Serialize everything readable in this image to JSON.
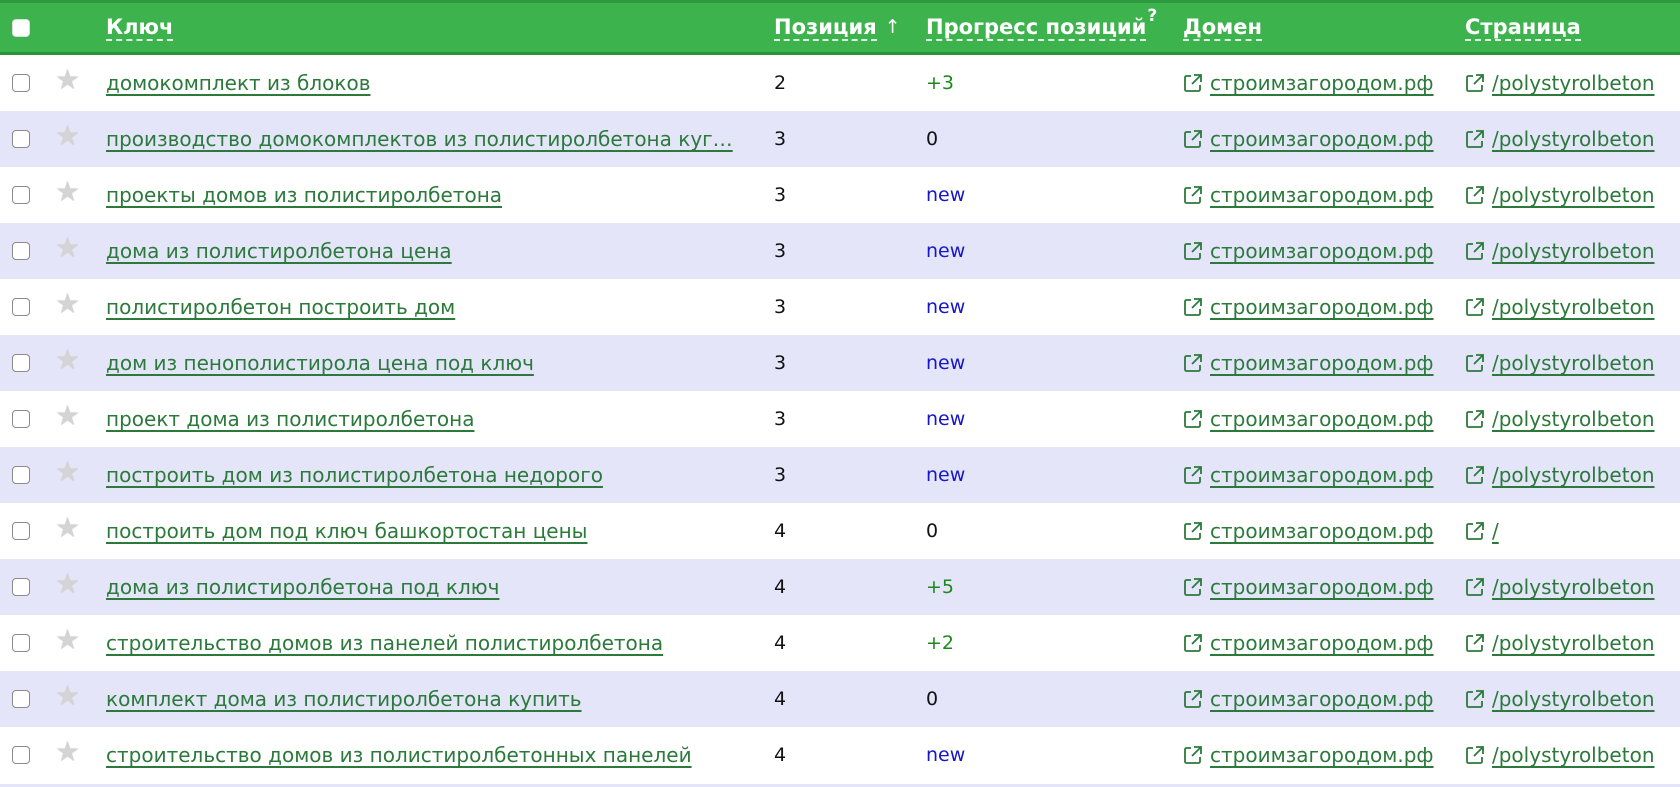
{
  "header": {
    "key_label": "Ключ",
    "position_label": "Позиция",
    "sort_indicator": "↑",
    "progress_label": "Прогресс позиций",
    "progress_help": "?",
    "domain_label": "Домен",
    "page_label": "Страница"
  },
  "icons": {
    "star": "star-icon",
    "external": "external-link-icon"
  },
  "colors": {
    "header_bg": "#3db34d",
    "alt_row_bg": "#e5e5fa",
    "link": "#2b7a3b",
    "positive": "#1a8a1a",
    "new": "#1616c8"
  },
  "rows": [
    {
      "key": "домокомплект из блоков",
      "position": "2",
      "progress": "+3",
      "progress_type": "up",
      "domain": "строимзагородом.рф",
      "page": "/polystyrolbeton"
    },
    {
      "key": "производство домокомплектов из полистиролбетона куг…",
      "position": "3",
      "progress": "0",
      "progress_type": "zero",
      "domain": "строимзагородом.рф",
      "page": "/polystyrolbeton"
    },
    {
      "key": "проекты домов из полистиролбетона",
      "position": "3",
      "progress": "new",
      "progress_type": "new",
      "domain": "строимзагородом.рф",
      "page": "/polystyrolbeton"
    },
    {
      "key": "дома из полистиролбетона цена",
      "position": "3",
      "progress": "new",
      "progress_type": "new",
      "domain": "строимзагородом.рф",
      "page": "/polystyrolbeton"
    },
    {
      "key": "полистиролбетон построить дом",
      "position": "3",
      "progress": "new",
      "progress_type": "new",
      "domain": "строимзагородом.рф",
      "page": "/polystyrolbeton"
    },
    {
      "key": "дом из пенополистирола цена под ключ",
      "position": "3",
      "progress": "new",
      "progress_type": "new",
      "domain": "строимзагородом.рф",
      "page": "/polystyrolbeton"
    },
    {
      "key": "проект дома из полистиролбетона",
      "position": "3",
      "progress": "new",
      "progress_type": "new",
      "domain": "строимзагородом.рф",
      "page": "/polystyrolbeton"
    },
    {
      "key": "построить дом из полистиролбетона недорого",
      "position": "3",
      "progress": "new",
      "progress_type": "new",
      "domain": "строимзагородом.рф",
      "page": "/polystyrolbeton"
    },
    {
      "key": "построить дом под ключ башкортостан цены",
      "position": "4",
      "progress": "0",
      "progress_type": "zero",
      "domain": "строимзагородом.рф",
      "page": "/"
    },
    {
      "key": "дома из полистиролбетона под ключ",
      "position": "4",
      "progress": "+5",
      "progress_type": "up",
      "domain": "строимзагородом.рф",
      "page": "/polystyrolbeton"
    },
    {
      "key": "строительство домов из панелей полистиролбетона",
      "position": "4",
      "progress": "+2",
      "progress_type": "up",
      "domain": "строимзагородом.рф",
      "page": "/polystyrolbeton"
    },
    {
      "key": "комплект дома из полистиролбетона купить",
      "position": "4",
      "progress": "0",
      "progress_type": "zero",
      "domain": "строимзагородом.рф",
      "page": "/polystyrolbeton"
    },
    {
      "key": "строительство домов из полистиролбетонных панелей",
      "position": "4",
      "progress": "new",
      "progress_type": "new",
      "domain": "строимзагородом.рф",
      "page": "/polystyrolbeton"
    }
  ]
}
